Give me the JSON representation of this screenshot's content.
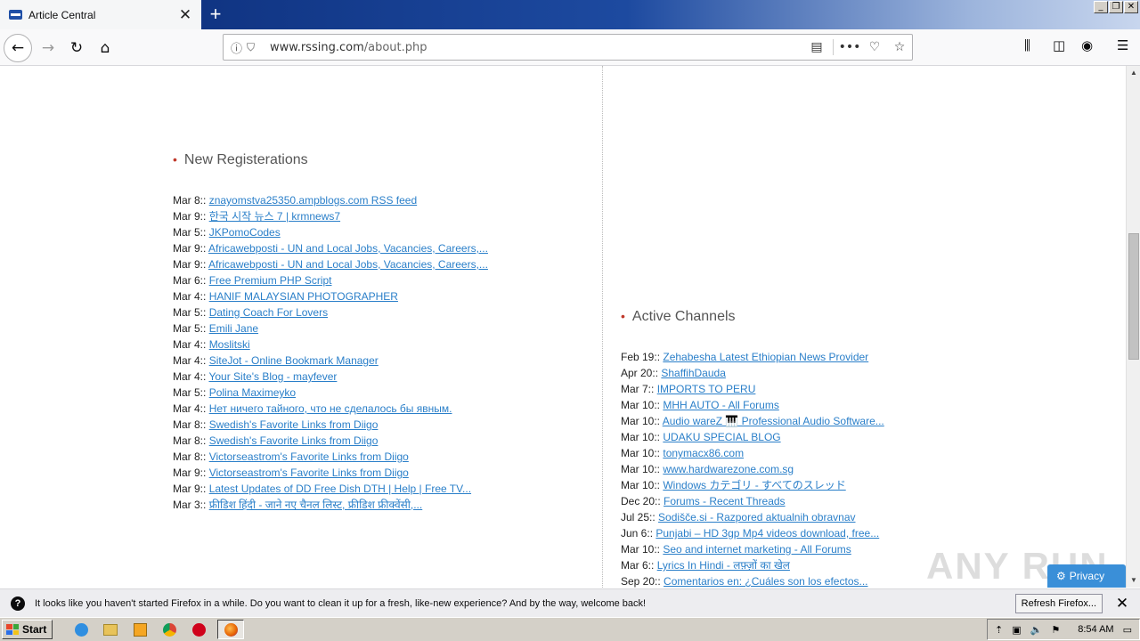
{
  "browser": {
    "tab_title": "Article Central",
    "new_tab_glyph": "+",
    "url_host": "www.rssing.com",
    "url_path": "/about.php",
    "window_controls": [
      "_",
      "❐",
      "✕"
    ]
  },
  "left_section": {
    "title": "New Registerations",
    "items": [
      {
        "date": "Mar 8::",
        "text": "znayomstva25350.ampblogs.com RSS feed"
      },
      {
        "date": "Mar 9::",
        "text": "한국 시작 뉴스 7 | krmnews7"
      },
      {
        "date": "Mar 5::",
        "text": "JKPomoCodes"
      },
      {
        "date": "Mar 9::",
        "text": "Africawebposti - UN and Local Jobs, Vacancies, Careers,..."
      },
      {
        "date": "Mar 9::",
        "text": "Africawebposti - UN and Local Jobs, Vacancies, Careers,..."
      },
      {
        "date": "Mar 6::",
        "text": "Free Premium PHP Script"
      },
      {
        "date": "Mar 4::",
        "text": "HANIF MALAYSIAN PHOTOGRAPHER"
      },
      {
        "date": "Mar 5::",
        "text": "Dating Coach For Lovers"
      },
      {
        "date": "Mar 5::",
        "text": "Emili Jane"
      },
      {
        "date": "Mar 4::",
        "text": "Moslitski"
      },
      {
        "date": "Mar 4::",
        "text": "SiteJot - Online Bookmark Manager"
      },
      {
        "date": "Mar 4::",
        "text": "Your Site's Blog - mayfever"
      },
      {
        "date": "Mar 5::",
        "text": "Polina Maximeyko"
      },
      {
        "date": "Mar 4::",
        "text": "Нет ничего тайного, что не сделалось бы явным."
      },
      {
        "date": "Mar 8::",
        "text": "Swedish's Favorite Links from Diigo"
      },
      {
        "date": "Mar 8::",
        "text": "Swedish's Favorite Links from Diigo"
      },
      {
        "date": "Mar 8::",
        "text": "Victorseastrom's Favorite Links from Diigo"
      },
      {
        "date": "Mar 9::",
        "text": "Victorseastrom's Favorite Links from Diigo"
      },
      {
        "date": "Mar 9::",
        "text": "Latest Updates of DD Free Dish DTH | Help | Free TV..."
      },
      {
        "date": "Mar 3::",
        "text": "फ्रीडिश हिंदी - जाने नए चैनल लिस्ट, फ्रीडिश फ्रीक्वेंसी,..."
      }
    ]
  },
  "right_section": {
    "title": "Active Channels",
    "items": [
      {
        "date": "Feb 19::",
        "text": "Zehabesha Latest Ethiopian News Provider"
      },
      {
        "date": "Apr 20::",
        "text": "ShaffihDauda"
      },
      {
        "date": "Mar 7::",
        "text": "IMPORTS TO PERU"
      },
      {
        "date": "Mar 10::",
        "text": "MHH AUTO - All Forums"
      },
      {
        "date": "Mar 10::",
        "text": "Audio wareZ 🎹 Professional Audio Software..."
      },
      {
        "date": "Mar 10::",
        "text": "UDAKU SPECIAL BLOG"
      },
      {
        "date": "Mar 10::",
        "text": "tonymacx86.com"
      },
      {
        "date": "Mar 10::",
        "text": "www.hardwarezone.com.sg"
      },
      {
        "date": "Mar 10::",
        "text": "Windows カテゴリ - すべてのスレッド"
      },
      {
        "date": "Dec 20::",
        "text": "Forums - Recent Threads"
      },
      {
        "date": "Jul 25::",
        "text": "Sodišče.si - Razpored aktualnih obravnav"
      },
      {
        "date": "Jun 6::",
        "text": "Punjabi – HD 3gp Mp4 videos download, free..."
      },
      {
        "date": "Mar 10::",
        "text": "Seo and internet marketing - All Forums"
      },
      {
        "date": "Mar 6::",
        "text": "Lyrics In Hindi - लफ़्ज़ों का खेल"
      },
      {
        "date": "Sep 20::",
        "text": "Comentarios en: ¿Cuáles son los efectos..."
      }
    ]
  },
  "overlay": {
    "watermark": "ANY RUN",
    "privacy_label": "Privacy"
  },
  "notification": {
    "icon": "?",
    "message": "It looks like you haven't started Firefox in a while. Do you want to clean it up for a fresh, like-new experience? And by the way, welcome back!",
    "button_label": "Refresh Firefox...",
    "close_glyph": "✕"
  },
  "taskbar": {
    "start_label": "Start",
    "clock": "8:54 AM"
  }
}
